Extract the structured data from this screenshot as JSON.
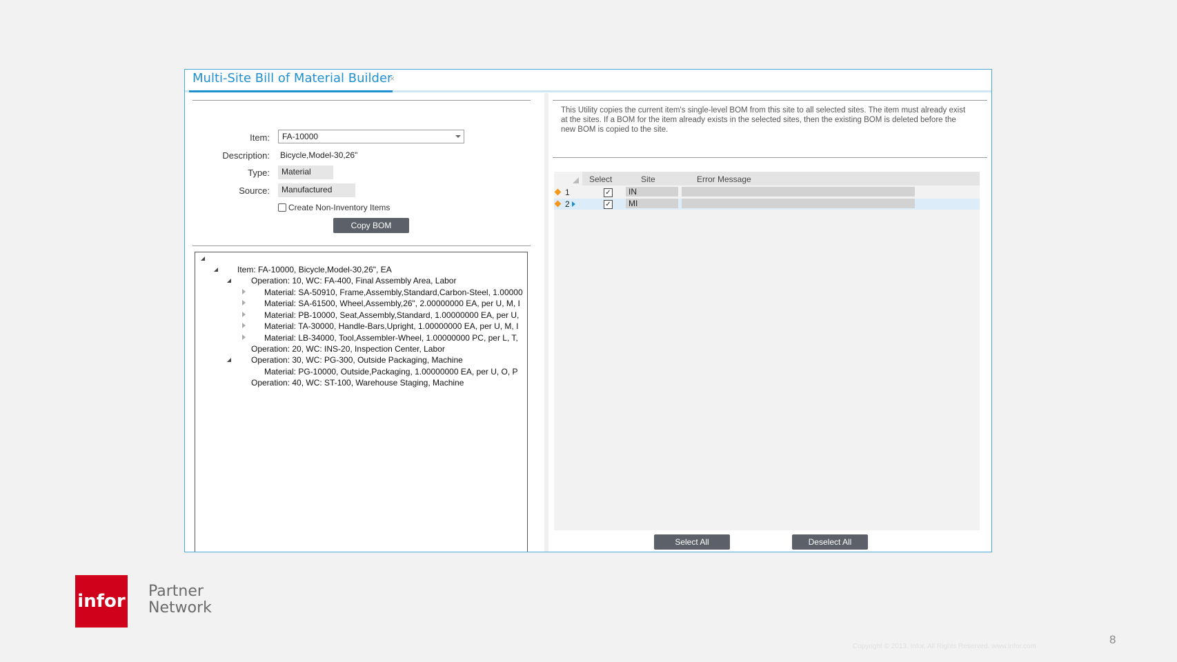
{
  "tab": {
    "title": "Multi-Site Bill of Material Builder",
    "close": "×"
  },
  "form": {
    "item_label": "Item:",
    "item_value": "FA-10000",
    "description_label": "Description:",
    "description_value": "Bicycle,Model-30,26\"",
    "type_label": "Type:",
    "type_value": "Material",
    "source_label": "Source:",
    "source_value": "Manufactured",
    "create_noninv_label": "Create Non-Inventory Items",
    "copy_bom_label": "Copy BOM"
  },
  "tree": {
    "rows": [
      "Item: FA-10000, Bicycle,Model-30,26\", EA",
      "Operation: 10, WC: FA-400, Final Assembly Area, Labor",
      "Material: SA-50910, Frame,Assembly,Standard,Carbon-Steel, 1.00000",
      "Material: SA-61500, Wheel,Assembly,26\", 2.00000000 EA, per U, M, I",
      "Material: PB-10000, Seat,Assembly,Standard, 1.00000000 EA, per U,",
      "Material: TA-30000, Handle-Bars,Upright, 1.00000000 EA, per U, M, I",
      "Material: LB-34000, Tool,Assembler-Wheel, 1.00000000 PC, per L, T,",
      "Operation: 20, WC: INS-20, Inspection Center, Labor",
      "Operation: 30, WC: PG-300, Outside Packaging, Machine",
      "Material: PG-10000, Outside,Packaging, 1.00000000 EA, per U, O, P",
      "Operation: 40, WC: ST-100, Warehouse Staging, Machine"
    ]
  },
  "info_text": "This Utility copies the current item's single-level BOM from this site to all selected sites. The item must already exist at the sites. If a BOM for the item already exists in the selected sites, then the existing BOM is deleted before the new BOM is copied to the site.",
  "grid": {
    "headers": {
      "select": "Select",
      "site": "Site",
      "error": "Error Message"
    },
    "rows": [
      {
        "num": "1",
        "checked": "✓",
        "site": "IN"
      },
      {
        "num": "2",
        "checked": "✓",
        "site": "MI"
      }
    ]
  },
  "buttons": {
    "select_all": "Select All",
    "deselect_all": "Deselect All"
  },
  "footer": {
    "logo": "infor",
    "partner_line1": "Partner",
    "partner_line2": "Network",
    "copyright": "Copyright © 2013. Infor. All Rights Reserved. www.infor.com",
    "page_number": "8"
  },
  "colors": {
    "accent": "#1e8fd0",
    "brand": "#d0021b",
    "button": "#5c6068",
    "diamond": "#f39a1e"
  }
}
